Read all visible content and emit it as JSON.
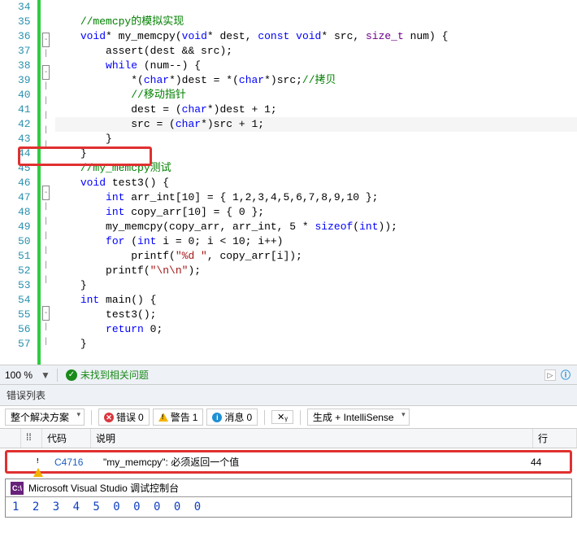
{
  "lines": {
    "start": 34,
    "end": 57
  },
  "code": {
    "l34": "",
    "l35_comment": "//memcpy的模拟实现",
    "l36_a": "void",
    "l36_b": "* my_memcpy(",
    "l36_c": "void",
    "l36_d": "* dest, ",
    "l36_e": "const",
    "l36_f": " ",
    "l36_g": "void",
    "l36_h": "* src, ",
    "l36_i": "size_t",
    "l36_j": " num) {",
    "l37_a": "assert",
    "l37_b": "(dest && src);",
    "l38_a": "while",
    "l38_b": " (num--) {",
    "l39_a": "*(",
    "l39_b": "char",
    "l39_c": "*)dest = *(",
    "l39_d": "char",
    "l39_e": "*)src;",
    "l39_f": "//拷贝",
    "l40_comment": "//移动指针",
    "l41_a": "dest = (",
    "l41_b": "char",
    "l41_c": "*)dest + 1;",
    "l42_a": "src = (",
    "l42_b": "char",
    "l42_c": "*)src + 1;",
    "l43": "}",
    "l44": "}",
    "l45_comment": "//my_memcpy测试",
    "l46_a": "void",
    "l46_b": " test3() {",
    "l47_a": "int",
    "l47_b": " arr_int[10] = { 1,2,3,4,5,6,7,8,9,10 };",
    "l48_a": "int",
    "l48_b": " copy_arr[10] = { 0 };",
    "l49_a": "my_memcpy(copy_arr, arr_int, 5 * ",
    "l49_b": "sizeof",
    "l49_c": "(",
    "l49_d": "int",
    "l49_e": "));",
    "l50_a": "for",
    "l50_b": " (",
    "l50_c": "int",
    "l50_d": " i = 0; i < 10; i++)",
    "l51_a": "printf(",
    "l51_b": "\"%d \"",
    "l51_c": ", copy_arr[i]);",
    "l52_a": "printf(",
    "l52_b": "\"\\n\\n\"",
    "l52_c": ");",
    "l53": "}",
    "l54_a": "int",
    "l54_b": " main() {",
    "l55": "test3();",
    "l56_a": "return",
    "l56_b": " 0;",
    "l57": "}"
  },
  "status": {
    "zoom": "100 %",
    "no_issues": "未找到相关问题"
  },
  "error_panel": {
    "title": "错误列表",
    "scope": "整个解决方案",
    "errors_label": "错误",
    "errors_count": "0",
    "warnings_label": "警告",
    "warnings_count": "1",
    "messages_label": "消息",
    "messages_count": "0",
    "build_mode": "生成 + IntelliSense",
    "col_code": "代码",
    "col_desc": "说明",
    "col_line": "行",
    "row": {
      "code": "C4716",
      "desc": "\"my_memcpy\": 必须返回一个值",
      "line": "44"
    }
  },
  "console": {
    "title": "Microsoft Visual Studio 调试控制台",
    "output": "1 2 3 4 5 0 0 0 0 0"
  }
}
